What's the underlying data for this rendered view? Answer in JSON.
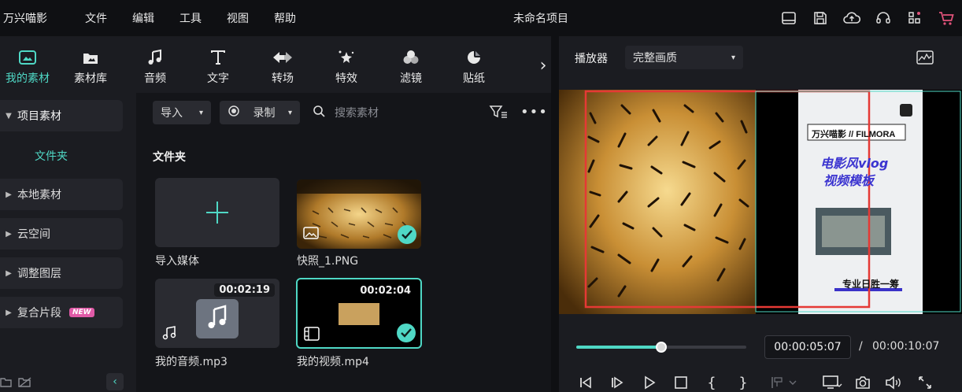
{
  "app": {
    "brand": "万兴喵影",
    "menu": [
      "文件",
      "编辑",
      "工具",
      "视图",
      "帮助"
    ],
    "project_title": "未命名项目",
    "title_icons": [
      "layout-icon",
      "save-icon",
      "cloud-upload-icon",
      "headset-icon",
      "apps-grid-icon",
      "cart-icon"
    ]
  },
  "toolbar": {
    "items": [
      {
        "label": "我的素材",
        "icon": "my-media-icon",
        "active": true
      },
      {
        "label": "素材库",
        "icon": "stock-media-icon"
      },
      {
        "label": "音频",
        "icon": "audio-icon"
      },
      {
        "label": "文字",
        "icon": "text-icon"
      },
      {
        "label": "转场",
        "icon": "transition-icon"
      },
      {
        "label": "特效",
        "icon": "effects-icon"
      },
      {
        "label": "滤镜",
        "icon": "filter-icon"
      },
      {
        "label": "贴纸",
        "icon": "sticker-icon"
      }
    ],
    "more": "›"
  },
  "leftnav": {
    "items": [
      {
        "label": "项目素材",
        "open": true
      },
      {
        "label": "本地素材"
      },
      {
        "label": "云空间"
      },
      {
        "label": "调整图层"
      },
      {
        "label": "复合片段",
        "badge": "NEW"
      }
    ],
    "sub_item": "文件夹"
  },
  "media": {
    "import_label": "导入",
    "record_label": "录制",
    "search_placeholder": "搜索素材",
    "section_title": "文件夹",
    "cards": [
      {
        "label": "导入媒体",
        "kind": "import"
      },
      {
        "label": "快照_1.PNG",
        "kind": "image",
        "checked": true
      },
      {
        "label": "我的音频.mp3",
        "kind": "audio",
        "duration": "00:02:19"
      },
      {
        "label": "我的视频.mp4",
        "kind": "video",
        "duration": "00:02:04",
        "checked": true,
        "selected": true
      }
    ]
  },
  "player": {
    "label": "播放器",
    "quality": "完整画质",
    "current_time": "00:00:05:07",
    "separator": "/",
    "total_time": "00:00:10:07",
    "progress": 0.5,
    "preview": {
      "brand_line": "万兴喵影 // FILMORA",
      "headline_1": "电影风vlog",
      "headline_2": "视频模板",
      "footer": "专业日胜一筹"
    }
  },
  "colors": {
    "accent": "#4fd8c5",
    "badge": "#e05aa7",
    "cart": "#e0527a",
    "overlay_red": "#e53935"
  }
}
